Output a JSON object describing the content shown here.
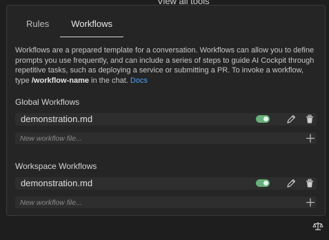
{
  "top_fragment": "View all tools",
  "tabs": [
    {
      "label": "Rules"
    },
    {
      "label": "Workflows"
    }
  ],
  "description": {
    "text1": "Workflows are a prepared template for a conversation. Workflows can allow you to define prompts you use frequently, and can include a series of steps to guide AI Cockpit through repetitive tasks, such as deploying a service or submitting a PR. To invoke a workflow, type ",
    "command": "/workflow-name",
    "text2": " in the chat. ",
    "link": "Docs"
  },
  "global": {
    "title": "Global Workflows",
    "item": {
      "name": "demonstration.md",
      "enabled": true
    },
    "new_placeholder": "New workflow file..."
  },
  "workspace": {
    "title": "Workspace Workflows",
    "item": {
      "name": "demonstration.md",
      "enabled": true
    },
    "new_placeholder": "New workflow file..."
  },
  "colors": {
    "toggle_on": "#65b07b",
    "link": "#4ea1f3"
  },
  "icons": {
    "edit": "pencil-icon",
    "delete": "trash-icon",
    "add": "plus-icon",
    "footer": "scale-icon"
  }
}
